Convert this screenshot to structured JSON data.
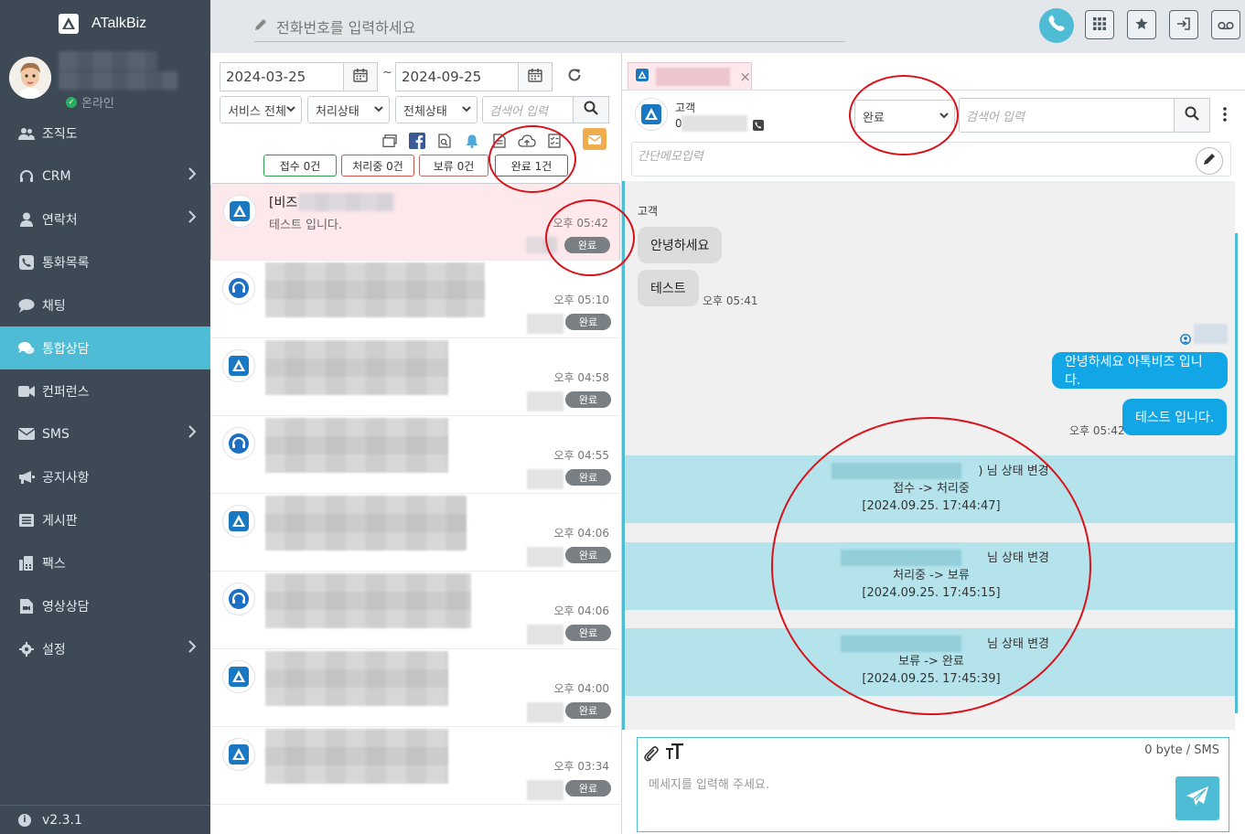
{
  "app": {
    "name": "ATalkBiz",
    "version": "v2.3.1"
  },
  "profile": {
    "status": "온라인"
  },
  "menu": [
    {
      "label": "조직도",
      "icon": "users-icon",
      "has_children": false,
      "active": false
    },
    {
      "label": "CRM",
      "icon": "headset-icon",
      "has_children": true,
      "active": false
    },
    {
      "label": "연락처",
      "icon": "user-icon",
      "has_children": true,
      "active": false
    },
    {
      "label": "통화목록",
      "icon": "phone-square-icon",
      "has_children": false,
      "active": false
    },
    {
      "label": "채팅",
      "icon": "chat-icon",
      "has_children": false,
      "active": false
    },
    {
      "label": "통합상담",
      "icon": "chats-icon",
      "has_children": false,
      "active": true
    },
    {
      "label": "컨퍼런스",
      "icon": "video-icon",
      "has_children": false,
      "active": false
    },
    {
      "label": "SMS",
      "icon": "envelope-icon",
      "has_children": true,
      "active": false
    },
    {
      "label": "공지사항",
      "icon": "megaphone-icon",
      "has_children": false,
      "active": false
    },
    {
      "label": "게시판",
      "icon": "list-icon",
      "has_children": false,
      "active": false
    },
    {
      "label": "팩스",
      "icon": "fax-icon",
      "has_children": false,
      "active": false
    },
    {
      "label": "영상상담",
      "icon": "video-file-icon",
      "has_children": false,
      "active": false
    },
    {
      "label": "설정",
      "icon": "gear-icon",
      "has_children": true,
      "active": false
    }
  ],
  "topbar": {
    "phone_placeholder": "전화번호를 입력하세요"
  },
  "filters": {
    "date_from": "2024-03-25",
    "date_sep": "~",
    "date_to": "2024-09-25",
    "service": "서비스 전체",
    "process_status": "처리상태",
    "all_status": "전체상태",
    "search_placeholder": "검색어 입력"
  },
  "status_counts": [
    {
      "label": "접수 0건",
      "color": "#2e9b4e"
    },
    {
      "label": "처리중 0건",
      "color": "#d9534f"
    },
    {
      "label": "보류 0건",
      "color": "#b07070"
    },
    {
      "label": "완료 1건",
      "color": "#666666"
    }
  ],
  "conversations": [
    {
      "title": "[비즈",
      "message": "테스트 입니다.",
      "time": "오후 05:42",
      "status": "완료",
      "channel": "atalk",
      "selected": true
    },
    {
      "title": "",
      "message": "",
      "time": "오후 05:10",
      "status": "완료",
      "channel": "support",
      "selected": false
    },
    {
      "title": "",
      "message": "",
      "time": "오후 04:58",
      "status": "완료",
      "channel": "atalk",
      "selected": false
    },
    {
      "title": "",
      "message": "",
      "time": "오후 04:55",
      "status": "완료",
      "channel": "support",
      "selected": false
    },
    {
      "title": "",
      "message": "",
      "time": "오후 04:06",
      "status": "완료",
      "channel": "atalk",
      "selected": false
    },
    {
      "title": "",
      "message": "",
      "time": "오후 04:06",
      "status": "완료",
      "channel": "support",
      "selected": false
    },
    {
      "title": "",
      "message": "",
      "time": "오후 04:00",
      "status": "완료",
      "channel": "atalk",
      "selected": false
    },
    {
      "title": "",
      "message": "",
      "time": "오후 03:34",
      "status": "완료",
      "channel": "atalk",
      "selected": false
    }
  ],
  "chat": {
    "tab_close": "×",
    "customer_label": "고객",
    "customer_phone": "0",
    "status_value": "완료",
    "search_placeholder": "검색어 입력",
    "memo_placeholder": "간단메모입력",
    "sender_label": "고객",
    "messages_in": [
      {
        "text": "안녕하세요",
        "time": ""
      },
      {
        "text": "테스트",
        "time": "오후 05:41"
      }
    ],
    "messages_out": [
      {
        "text": "안녕하세요 아톡비즈 입니다.",
        "time": ""
      },
      {
        "text": "테스트 입니다.",
        "time": "오후 05:42"
      }
    ],
    "system_messages": [
      {
        "title": ") 님 상태 변경",
        "change": "접수 -> 처리중",
        "stamp": "[2024.09.25. 17:44:47]"
      },
      {
        "title": "님 상태 변경",
        "change": "처리중 -> 보류",
        "stamp": "[2024.09.25. 17:45:15]"
      },
      {
        "title": "님 상태 변경",
        "change": "보류 -> 완료",
        "stamp": "[2024.09.25. 17:45:39]"
      }
    ],
    "byte_counter": "0 byte / SMS",
    "compose_placeholder": "메세지를 입력해 주세요."
  },
  "colors": {
    "accent": "#4fbcd5",
    "sidebar": "#3d4a56",
    "outgoing": "#12a6e6",
    "system": "#b4e3ec",
    "annotation": "#d9121a"
  }
}
